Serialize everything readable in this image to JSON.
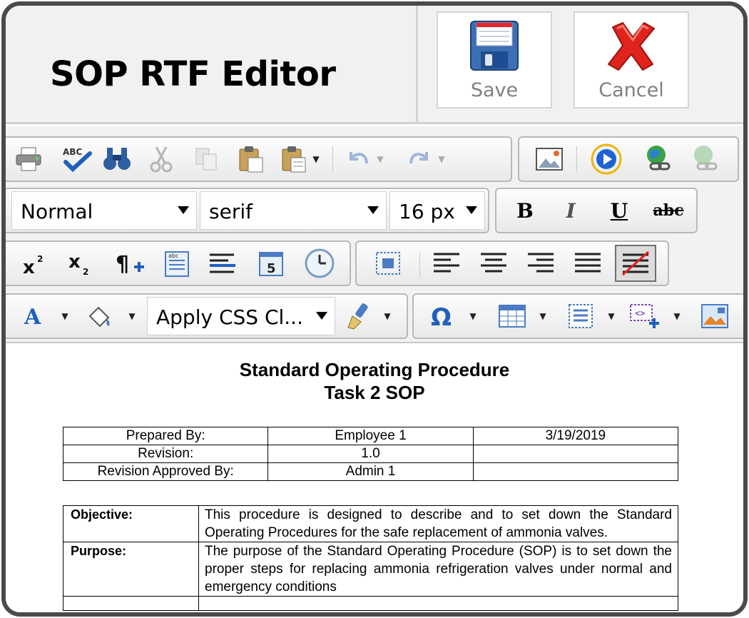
{
  "app": {
    "title": "SOP RTF Editor"
  },
  "header": {
    "save_label": "Save",
    "cancel_label": "Cancel"
  },
  "toolbar": {
    "format_block": "Normal",
    "font_family": "serif",
    "font_size": "16 px",
    "css_class": "Apply CSS Cl...",
    "bold_glyph": "B",
    "italic_glyph": "I",
    "underline_glyph": "U",
    "strike_glyph": "abc",
    "colors": {
      "underline_red": "#e0231c",
      "accent_blue": "#1f5fbf"
    }
  },
  "document": {
    "title_line1": "Standard Operating Procedure",
    "title_line2": "Task 2 SOP",
    "info_rows": [
      [
        "Prepared By:",
        "Employee 1",
        "3/19/2019"
      ],
      [
        "Revision:",
        "1.0",
        ""
      ],
      [
        "Revision Approved By:",
        "Admin 1",
        ""
      ]
    ],
    "sections": [
      {
        "label": "Objective:",
        "text": "This procedure is designed to describe and to set down the Standard Operating Procedures for the safe replacement of ammonia valves."
      },
      {
        "label": "Purpose:",
        "text": "The purpose of the Standard Operating Procedure (SOP) is to set down the proper steps for replacing ammonia refrigeration valves under normal and emergency conditions"
      }
    ]
  }
}
